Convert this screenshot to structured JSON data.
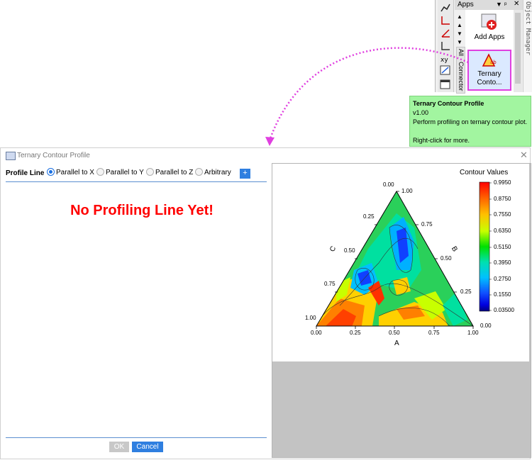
{
  "apps_panel": {
    "title": "Apps",
    "header_controls": [
      "▼",
      "ᵖ",
      "✕"
    ],
    "items": [
      {
        "label": "Add Apps",
        "icon": "add-apps-icon"
      },
      {
        "label_line1": "Ternary",
        "label_line2": "Conto...",
        "icon": "ternary-contour-icon"
      }
    ],
    "vertical_tabs": [
      "All",
      "Connector"
    ],
    "object_manager_label": "Object Manager",
    "highlight_color": "#e040e0"
  },
  "tooltip": {
    "title": "Ternary Contour Profile",
    "version": "v1.00",
    "description": "Perform profiling on ternary contour plot.",
    "hint": "Right-click for more."
  },
  "dialog": {
    "title": "Ternary Contour Profile",
    "close_glyph": "✕",
    "profile_line_label": "Profile Line",
    "radio_options": [
      {
        "label": "Parallel to X",
        "checked": true
      },
      {
        "label": "Parallel to Y",
        "checked": false
      },
      {
        "label": "Parallel to Z",
        "checked": false
      },
      {
        "label": "Arbitrary",
        "checked": false
      }
    ],
    "add_button": "+",
    "message": "No Profiling Line Yet!",
    "ok_button": "OK",
    "cancel_button": "Cancel",
    "accent_color": "#2f7fe0",
    "message_color": "#ff0000"
  },
  "chart_data": {
    "type": "heatmap",
    "subtype": "ternary contour",
    "legend_title": "Contour Values",
    "legend_levels": [
      "0.9950",
      "0.8750",
      "0.7550",
      "0.6350",
      "0.5150",
      "0.3950",
      "0.2750",
      "0.1550",
      "0.03500"
    ],
    "colormap": [
      "#ff0000",
      "#ff8000",
      "#ffd200",
      "#c8ff00",
      "#00e000",
      "#00e0a0",
      "#00c8ff",
      "#1060ff",
      "#0000ff",
      "#000080"
    ],
    "axis_a": {
      "label": "A",
      "ticks": [
        "0.00",
        "0.25",
        "0.50",
        "0.75",
        "1.00"
      ]
    },
    "axis_b": {
      "label": "B",
      "ticks": [
        "1.00",
        "0.75",
        "0.50",
        "0.25",
        "0.00"
      ]
    },
    "axis_c": {
      "label": "C",
      "ticks": [
        "0.00",
        "0.25",
        "0.50",
        "0.75",
        "1.00"
      ]
    }
  }
}
